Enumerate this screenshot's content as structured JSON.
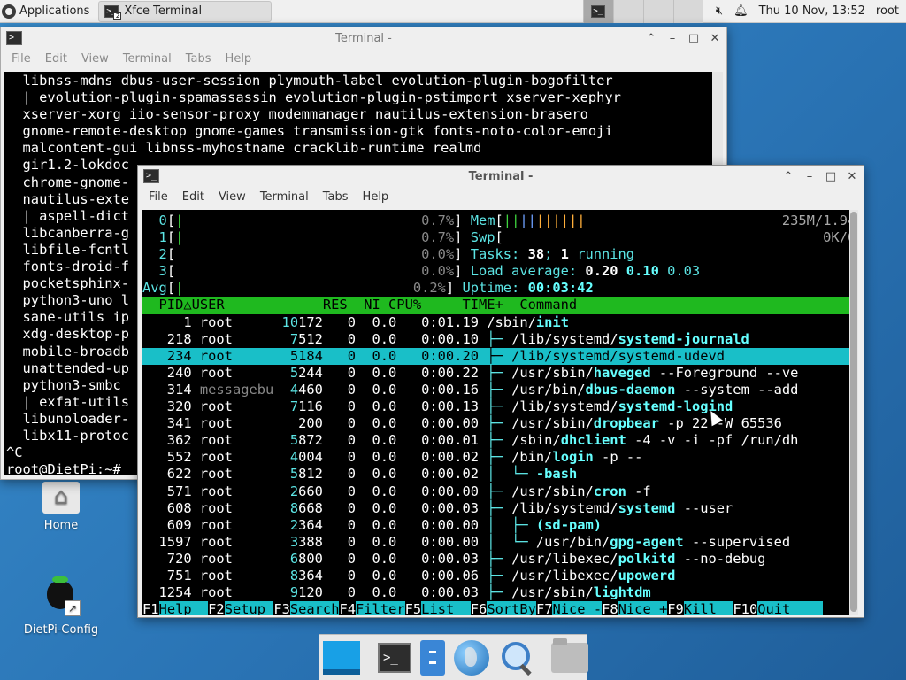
{
  "panel": {
    "applications_label": "Applications",
    "task_label": "Xfce Terminal",
    "task_count": "2",
    "clock": "Thu 10 Nov, 13:52",
    "user": "root"
  },
  "back_window": {
    "title": "Terminal -",
    "menu": [
      "File",
      "Edit",
      "View",
      "Terminal",
      "Tabs",
      "Help"
    ],
    "lines": [
      "  libnss-mdns dbus-user-session plymouth-label evolution-plugin-bogofilter",
      "  | evolution-plugin-spamassassin evolution-plugin-pstimport xserver-xephyr",
      "  xserver-xorg iio-sensor-proxy modemmanager nautilus-extension-brasero",
      "  gnome-remote-desktop gnome-games transmission-gtk fonts-noto-color-emoji",
      "  malcontent-gui libnss-myhostname cracklib-runtime realmd",
      "  gir1.2-lokdoc",
      "  chrome-gnome-",
      "  nautilus-exte",
      "  | aspell-dict",
      "  libcanberra-g",
      "  libfile-fcntl",
      "  fonts-droid-f",
      "  pocketsphinx-",
      "  python3-uno l",
      "  sane-utils ip",
      "  xdg-desktop-p",
      "  mobile-broadb",
      "  unattended-up",
      "  python3-smbc ",
      "  | exfat-utils",
      "  libunoloader-",
      "  libx11-protoc",
      "^C",
      "root@DietPi:~#"
    ]
  },
  "front_window": {
    "title": "Terminal -",
    "menu": [
      "File",
      "Edit",
      "View",
      "Terminal",
      "Tabs",
      "Help"
    ],
    "meters": {
      "cpu": [
        {
          "label": "0",
          "pct": "0.7%"
        },
        {
          "label": "1",
          "pct": "0.7%"
        },
        {
          "label": "2",
          "pct": "0.0%"
        },
        {
          "label": "3",
          "pct": "0.0%"
        },
        {
          "label": "Avg",
          "pct": "0.2%"
        }
      ],
      "mem_label": "Mem",
      "mem_value": "235M/1.94G",
      "swp_label": "Swp",
      "swp_value": "0K/0K",
      "tasks_label": "Tasks:",
      "tasks_count": "38",
      "running_count": "1",
      "running_label": "running",
      "load_label": "Load average:",
      "load_1": "0.20",
      "load_5": "0.10",
      "load_15": "0.03",
      "uptime_label": "Uptime:",
      "uptime": "00:03:42"
    },
    "columns": [
      "PID",
      "USER",
      "RES",
      "NI",
      "CPU%",
      "TIME+",
      "Command"
    ],
    "processes": [
      {
        "pid": "1",
        "user": "root",
        "res": "10172",
        "ni": "0",
        "cpu": "0.0",
        "time": "0:01.19",
        "tree": "",
        "path": "/sbin/",
        "name": "init",
        "args": ""
      },
      {
        "pid": "218",
        "user": "root",
        "res": "7512",
        "ni": "0",
        "cpu": "0.0",
        "time": "0:00.10",
        "tree": "├─ ",
        "path": "/lib/systemd/",
        "name": "systemd-journald",
        "args": ""
      },
      {
        "pid": "234",
        "user": "root",
        "res": "5184",
        "ni": "0",
        "cpu": "0.0",
        "time": "0:00.20",
        "tree": "├─ ",
        "path": "/lib/systemd/",
        "name": "systemd-udevd",
        "args": ""
      },
      {
        "pid": "240",
        "user": "root",
        "res": "5244",
        "ni": "0",
        "cpu": "0.0",
        "time": "0:00.22",
        "tree": "├─ ",
        "path": "/usr/sbin/",
        "name": "haveged",
        "args": " --Foreground --ve"
      },
      {
        "pid": "314",
        "user": "messagebu",
        "res": "4460",
        "ni": "0",
        "cpu": "0.0",
        "time": "0:00.16",
        "tree": "├─ ",
        "path": "/usr/bin/",
        "name": "dbus-daemon",
        "args": " --system --add"
      },
      {
        "pid": "320",
        "user": "root",
        "res": "7116",
        "ni": "0",
        "cpu": "0.0",
        "time": "0:00.13",
        "tree": "├─ ",
        "path": "/lib/systemd/",
        "name": "systemd-logind",
        "args": ""
      },
      {
        "pid": "341",
        "user": "root",
        "res": "200",
        "ni": "0",
        "cpu": "0.0",
        "time": "0:00.00",
        "tree": "├─ ",
        "path": "/usr/sbin/",
        "name": "dropbear",
        "args": " -p 22 -W 65536"
      },
      {
        "pid": "362",
        "user": "root",
        "res": "5872",
        "ni": "0",
        "cpu": "0.0",
        "time": "0:00.01",
        "tree": "├─ ",
        "path": "/sbin/",
        "name": "dhclient",
        "args": " -4 -v -i -pf /run/dh"
      },
      {
        "pid": "552",
        "user": "root",
        "res": "4004",
        "ni": "0",
        "cpu": "0.0",
        "time": "0:00.02",
        "tree": "├─ ",
        "path": "/bin/",
        "name": "login",
        "args": " -p --"
      },
      {
        "pid": "622",
        "user": "root",
        "res": "5812",
        "ni": "0",
        "cpu": "0.0",
        "time": "0:00.02",
        "tree": "│  └─ ",
        "path": "",
        "name": "-bash",
        "args": ""
      },
      {
        "pid": "571",
        "user": "root",
        "res": "2660",
        "ni": "0",
        "cpu": "0.0",
        "time": "0:00.00",
        "tree": "├─ ",
        "path": "/usr/sbin/",
        "name": "cron",
        "args": " -f"
      },
      {
        "pid": "608",
        "user": "root",
        "res": "8668",
        "ni": "0",
        "cpu": "0.0",
        "time": "0:00.03",
        "tree": "├─ ",
        "path": "/lib/systemd/",
        "name": "systemd",
        "args": " --user"
      },
      {
        "pid": "609",
        "user": "root",
        "res": "2364",
        "ni": "0",
        "cpu": "0.0",
        "time": "0:00.00",
        "tree": "│  ├─ ",
        "path": "",
        "name": "(sd-pam)",
        "args": ""
      },
      {
        "pid": "1597",
        "user": "root",
        "res": "3388",
        "ni": "0",
        "cpu": "0.0",
        "time": "0:00.00",
        "tree": "│  └─ ",
        "path": "/usr/bin/",
        "name": "gpg-agent",
        "args": " --supervised"
      },
      {
        "pid": "720",
        "user": "root",
        "res": "6800",
        "ni": "0",
        "cpu": "0.0",
        "time": "0:00.03",
        "tree": "├─ ",
        "path": "/usr/libexec/",
        "name": "polkitd",
        "args": " --no-debug"
      },
      {
        "pid": "751",
        "user": "root",
        "res": "8364",
        "ni": "0",
        "cpu": "0.0",
        "time": "0:00.06",
        "tree": "├─ ",
        "path": "/usr/libexec/",
        "name": "upowerd",
        "args": ""
      },
      {
        "pid": "1254",
        "user": "root",
        "res": "9120",
        "ni": "0",
        "cpu": "0.0",
        "time": "0:00.03",
        "tree": "├─ ",
        "path": "/usr/sbin/",
        "name": "lightdm",
        "args": ""
      }
    ],
    "selected_index": 2,
    "fkeys": [
      {
        "key": "F1",
        "label": "Help  "
      },
      {
        "key": "F2",
        "label": "Setup "
      },
      {
        "key": "F3",
        "label": "Search"
      },
      {
        "key": "F4",
        "label": "Filter"
      },
      {
        "key": "F5",
        "label": "List  "
      },
      {
        "key": "F6",
        "label": "SortBy"
      },
      {
        "key": "F7",
        "label": "Nice -"
      },
      {
        "key": "F8",
        "label": "Nice +"
      },
      {
        "key": "F9",
        "label": "Kill  "
      },
      {
        "key": "F10",
        "label": "Quit"
      }
    ]
  },
  "desktop_icons": [
    {
      "label": "Home"
    },
    {
      "label": "DietPi-Config"
    }
  ],
  "colors": {
    "htop_header": "#1fb91f",
    "htop_select": "#19bfc8",
    "desktop": "#2f7fbf"
  }
}
